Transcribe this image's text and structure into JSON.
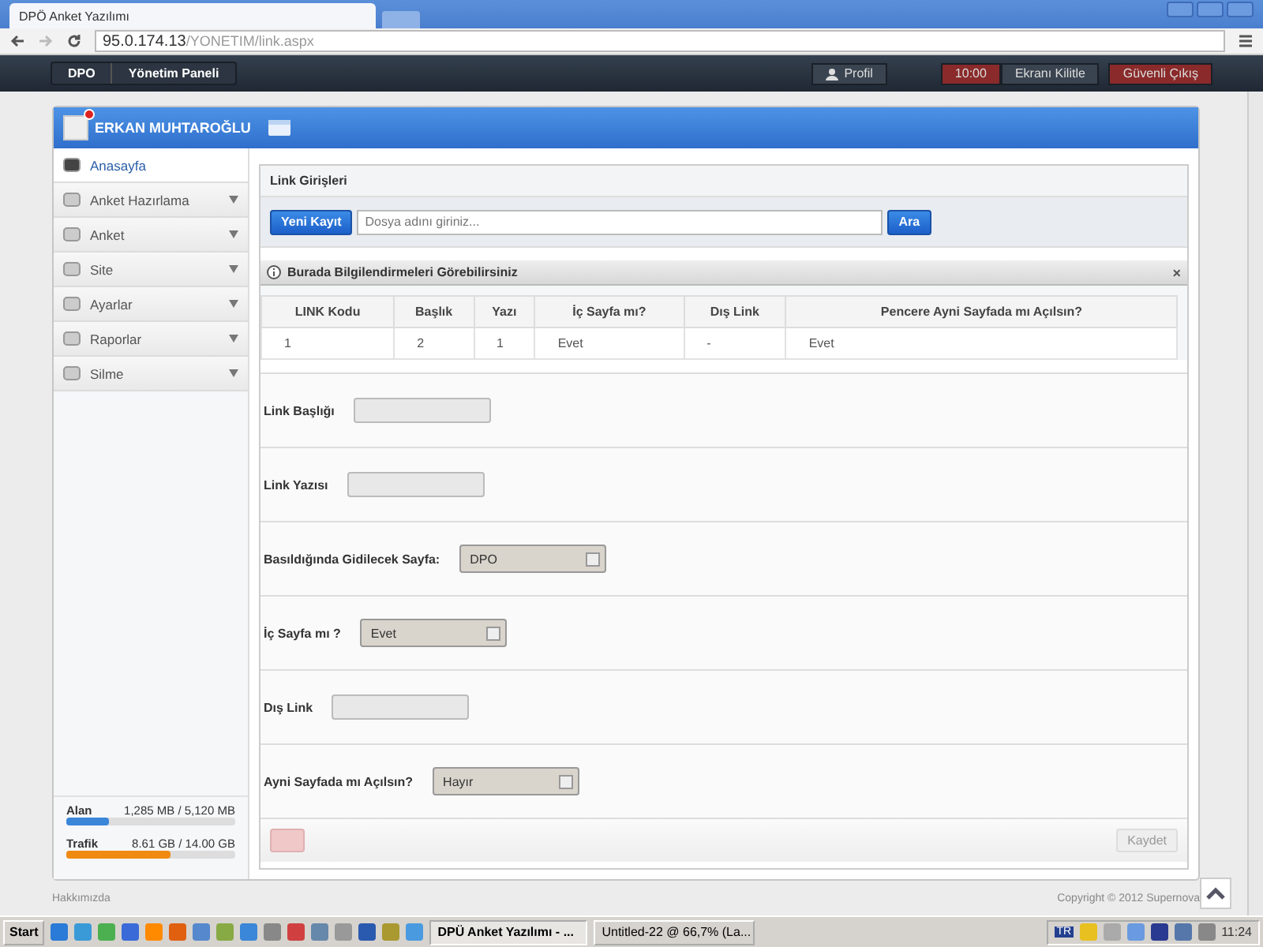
{
  "browser": {
    "tab_title": "DPÖ Anket Yazılımı",
    "url_host": "95.0.174.13",
    "url_path": "/YONETIM/link.aspx"
  },
  "navbar": {
    "breadcrumbs": [
      "DPO",
      "Yönetim Paneli"
    ],
    "profile": "Profil",
    "timer": "10:00",
    "lock": "Ekranı Kilitle",
    "logout": "Güvenli Çıkış"
  },
  "user": {
    "name": "ERKAN MUHTAROĞLU"
  },
  "sidebar": {
    "items": [
      {
        "label": "Anasayfa",
        "selected": true,
        "expandable": false
      },
      {
        "label": "Anket Hazırlama",
        "selected": false,
        "expandable": true
      },
      {
        "label": "Anket",
        "selected": false,
        "expandable": true
      },
      {
        "label": "Site",
        "selected": false,
        "expandable": true
      },
      {
        "label": "Ayarlar",
        "selected": false,
        "expandable": true
      },
      {
        "label": "Raporlar",
        "selected": false,
        "expandable": true
      },
      {
        "label": "Silme",
        "selected": false,
        "expandable": true
      }
    ],
    "usage": [
      {
        "label": "Alan",
        "reading": "1,285 MB / 5,120 MB",
        "level": 0.25,
        "color": "#3a86d8"
      },
      {
        "label": "Trafik",
        "reading": "8.61 GB / 14.00 GB",
        "level": 0.615,
        "color": "#f08a10"
      }
    ]
  },
  "panel": {
    "title": "Link Girişleri",
    "new_button": "Yeni Kayıt",
    "search": {
      "placeholder": "Dosya adını giriniz..."
    },
    "search_button": "Ara"
  },
  "info": {
    "text": "Burada Bilgilendirmeleri Görebilirsiniz",
    "close": "×"
  },
  "table": {
    "columns": [
      "LINK Kodu",
      "Başlık",
      "Yazı",
      "İç Sayfa mı?",
      "Dış Link",
      "Pencere Ayni Sayfada mı Açılsın?"
    ],
    "rows": [
      [
        "1",
        "2",
        "1",
        "Evet",
        "-",
        "Evet"
      ]
    ]
  },
  "form": [
    {
      "kind": "text",
      "label": "Link Başlığı"
    },
    {
      "kind": "text",
      "label": "Link Yazısı"
    },
    {
      "kind": "select",
      "label": "Basıldığında Gidilecek Sayfa:",
      "value": "DPO"
    },
    {
      "kind": "select",
      "label": "İç Sayfa mı ?",
      "value": "Evet"
    },
    {
      "kind": "text",
      "label": "Dış Link"
    },
    {
      "kind": "select",
      "label": "Ayni Sayfada mı Açılsın?",
      "value": "Hayır"
    }
  ],
  "save": {
    "label": "Kaydet",
    "disabled": true
  },
  "footer": {
    "left": "Hakkımızda",
    "right": "Copyright © 2012 Supernova"
  },
  "taskbar": {
    "start": "Start",
    "tasks": [
      {
        "label": "DPÜ Anket Yazılımı - ...",
        "selected": true
      },
      {
        "label": "Untitled-22 @ 66,7% (La...",
        "selected": false
      }
    ],
    "lang": "TR",
    "clock": "11:24"
  }
}
